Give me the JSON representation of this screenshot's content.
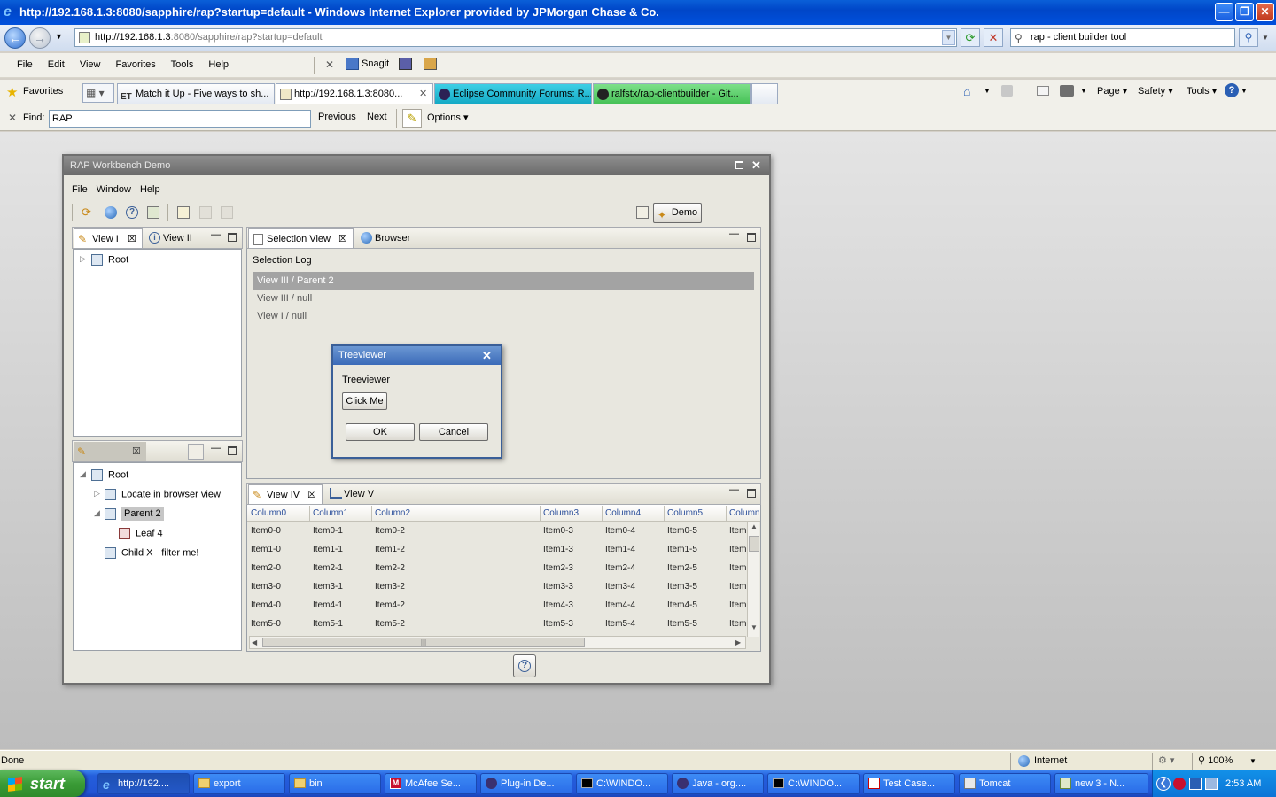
{
  "ie": {
    "title": "http://192.168.1.3:8080/sapphire/rap?startup=default - Windows Internet Explorer provided by JPMorgan Chase & Co.",
    "address_host": "http://192.168.1.3",
    "address_rest": ":8080/sapphire/rap?startup=default",
    "search_value": "rap - client builder tool",
    "menu": [
      "File",
      "Edit",
      "View",
      "Favorites",
      "Tools",
      "Help"
    ],
    "snagit_label": "Snagit",
    "favorites_label": "Favorites",
    "tabs": [
      "Match it Up - Five ways to sh...",
      "http://192.168.1.3:8080...",
      "Eclipse Community Forums: R...",
      "ralfstx/rap-clientbuilder - Git..."
    ],
    "command_bar": [
      "Page",
      "Safety",
      "Tools"
    ],
    "find_label": "Find:",
    "find_value": "RAP",
    "find_previous": "Previous",
    "find_next": "Next",
    "find_options": "Options",
    "status_text": "Done",
    "zone_text": "Internet",
    "zoom_text": "100%"
  },
  "rap": {
    "title": "RAP Workbench Demo",
    "menu": [
      "File",
      "Window",
      "Help"
    ],
    "perspective_label": "Demo",
    "view1_tab": "View I",
    "view2_tab": "View II",
    "tree1_root": "Root",
    "tree2": {
      "root": "Root",
      "item1": "Locate in browser view",
      "item2": "Parent 2",
      "item3": "Leaf 4",
      "item4": "Child X - filter me!"
    },
    "selection_tab": "Selection View",
    "browser_tab": "Browser",
    "selection_log_label": "Selection Log",
    "log": [
      "View III / Parent 2",
      "View III / null",
      "View I / null"
    ],
    "view4_tab": "View IV",
    "view5_tab": "View V",
    "table": {
      "columns": [
        "Column0",
        "Column1",
        "Column2",
        "Column3",
        "Column4",
        "Column5",
        "Column"
      ],
      "rows": [
        [
          "Item0-0",
          "Item0-1",
          "Item0-2",
          "Item0-3",
          "Item0-4",
          "Item0-5",
          "Item"
        ],
        [
          "Item1-0",
          "Item1-1",
          "Item1-2",
          "Item1-3",
          "Item1-4",
          "Item1-5",
          "Item"
        ],
        [
          "Item2-0",
          "Item2-1",
          "Item2-2",
          "Item2-3",
          "Item2-4",
          "Item2-5",
          "Item"
        ],
        [
          "Item3-0",
          "Item3-1",
          "Item3-2",
          "Item3-3",
          "Item3-4",
          "Item3-5",
          "Item"
        ],
        [
          "Item4-0",
          "Item4-1",
          "Item4-2",
          "Item4-3",
          "Item4-4",
          "Item4-5",
          "Item"
        ],
        [
          "Item5-0",
          "Item5-1",
          "Item5-2",
          "Item5-3",
          "Item5-4",
          "Item5-5",
          "Item"
        ]
      ]
    }
  },
  "dialog": {
    "title": "Treeviewer",
    "label": "Treeviewer",
    "click_me": "Click Me",
    "ok": "OK",
    "cancel": "Cancel"
  },
  "taskbar": {
    "start": "start",
    "items": [
      "http://192....",
      "export",
      "bin",
      "McAfee Se...",
      "Plug-in De...",
      "C:\\WINDO...",
      "Java - org....",
      "C:\\WINDO...",
      "Test Case...",
      "Tomcat",
      "new 3 - N..."
    ],
    "clock": "2:53 AM"
  }
}
